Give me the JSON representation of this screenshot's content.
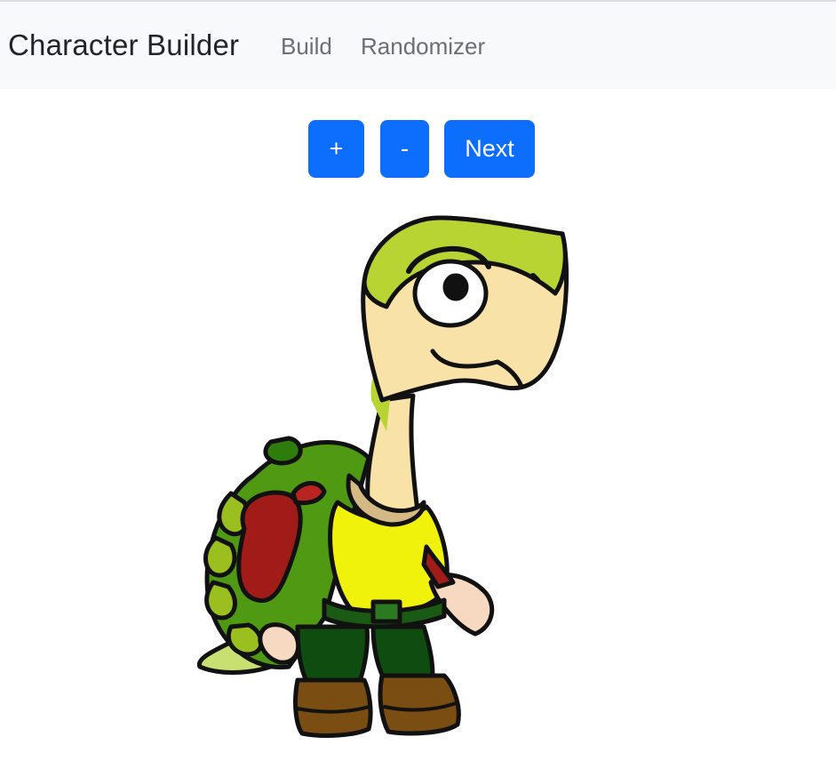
{
  "navbar": {
    "brand": "Character Builder",
    "links": [
      "Build",
      "Randomizer"
    ]
  },
  "controls": {
    "increase_label": "+",
    "decrease_label": "-",
    "next_label": "Next"
  },
  "character": {
    "name": "turtle-character"
  },
  "colors": {
    "navbar_bg": "#f8f9fa",
    "button_primary": "#0d6efd",
    "brand_text": "#212529",
    "nav_text": "#6b6f74"
  }
}
